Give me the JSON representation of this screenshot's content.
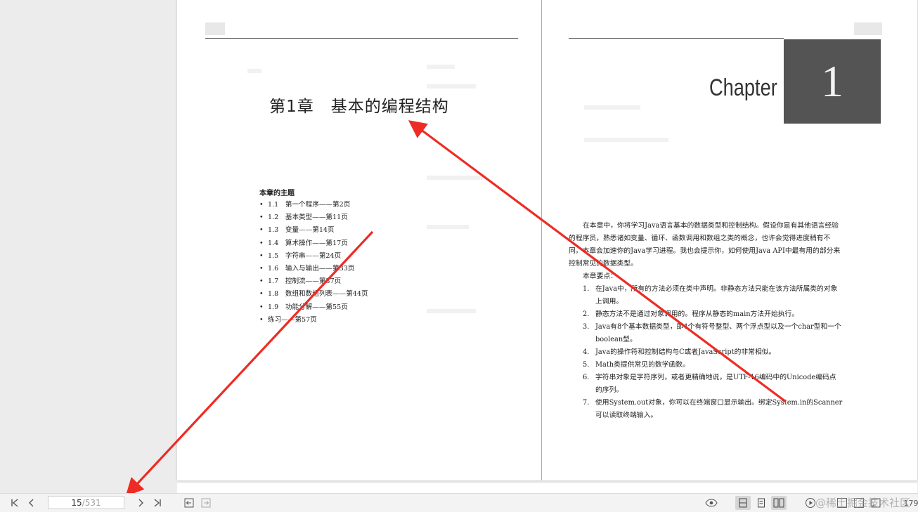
{
  "left_page": {
    "chapter_title": "第1章　基本的编程结构",
    "toc_heading": "本章的主题",
    "toc_items": [
      "1.1　第一个程序——第2页",
      "1.2　基本类型——第11页",
      "1.3　变量——第14页",
      "1.4　算术操作——第17页",
      "1.5　字符串——第24页",
      "1.6　输入与输出——第33页",
      "1.7　控制流——第37页",
      "1.8　数组和数组列表——第44页",
      "1.9　功能分解——第55页",
      "练习——第57页"
    ]
  },
  "right_page": {
    "chapter_word": "Chapter",
    "chapter_number": "1",
    "intro": "在本章中，你将学习Java语言基本的数据类型和控制结构。假设你是有其他语言经验的程序员，熟悉诸如变量、循环、函数调用和数组之类的概念，也许会觉得进度稍有不同。本章会加速你的Java学习进程。我也会提示你，如何使用Java API中最有用的部分来控制常见的数据类型。",
    "points_label": "本章要点：",
    "points": [
      "在Java中，所有的方法必须在类中声明。非静态方法只能在该方法所属类的对象上调用。",
      "静态方法不是通过对象调用的。程序从静态的main方法开始执行。",
      "Java有8个基本数据类型，即4个有符号整型、两个浮点型以及一个char型和一个boolean型。",
      "Java的操作符和控制结构与C或者JavaScript的非常相似。",
      "Math类提供常见的数学函数。",
      "字符串对象是字符序列，或者更精确地说，是UTF-16编码中的Unicode编码点的序列。",
      "使用System.out对象，你可以在终端窗口显示输出。绑定System.in的Scanner可以读取终端输入。"
    ],
    "point_numbers": [
      "1.",
      "2.",
      "3.",
      "4.",
      "5.",
      "6.",
      "7."
    ]
  },
  "toolbar": {
    "page_current": "15",
    "page_total": "/531",
    "icons": [
      "first-page-icon",
      "prev-page-icon",
      "next-page-icon",
      "last-page-icon",
      "back-icon",
      "forward-icon",
      "eye-icon",
      "single-page-icon",
      "continuous-page-icon",
      "two-page-icon",
      "play-icon",
      "zoom-icon"
    ],
    "watermark": "@稀土掘金技术社区",
    "zoom_partial": "179"
  },
  "colors": {
    "annotation": "#ee2b24",
    "chapter_box": "#545454",
    "background": "#ececec"
  }
}
